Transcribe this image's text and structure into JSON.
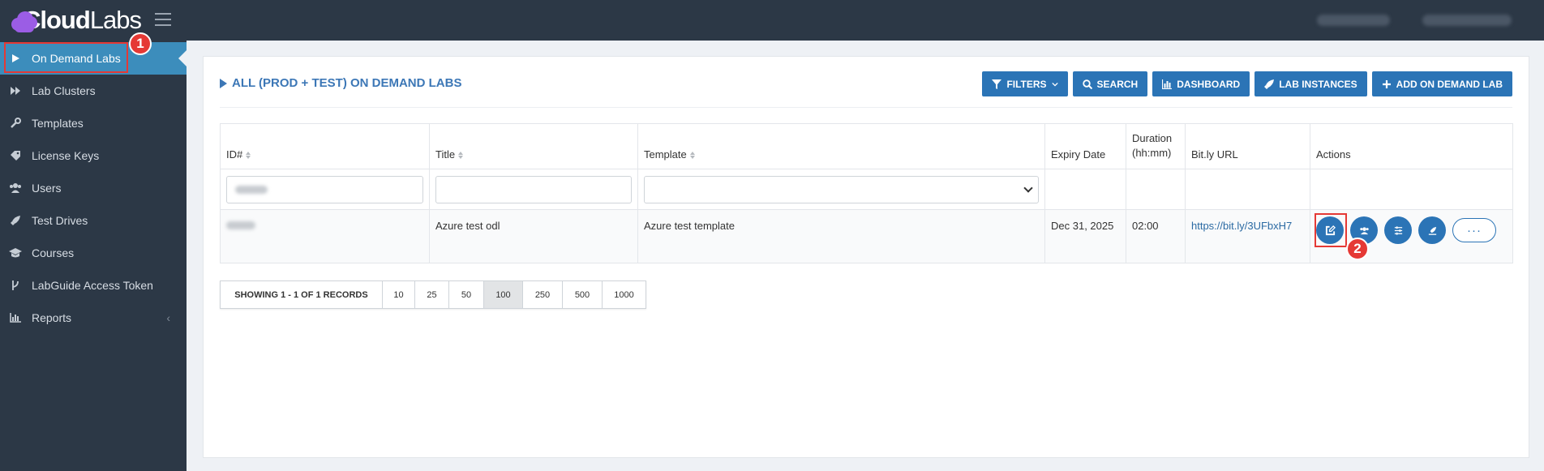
{
  "header": {
    "logo_bold": "Cloud",
    "logo_light": "Labs"
  },
  "sidebar": {
    "items": [
      {
        "label": "On Demand Labs",
        "icon": "play-icon",
        "active": true
      },
      {
        "label": "Lab Clusters",
        "icon": "fast-forward-icon"
      },
      {
        "label": "Templates",
        "icon": "wrench-icon"
      },
      {
        "label": "License Keys",
        "icon": "tag-icon"
      },
      {
        "label": "Users",
        "icon": "users-icon"
      },
      {
        "label": "Test Drives",
        "icon": "rocket-icon"
      },
      {
        "label": "Courses",
        "icon": "graduation-cap-icon"
      },
      {
        "label": "LabGuide Access Token",
        "icon": "branch-icon"
      },
      {
        "label": "Reports",
        "icon": "bar-chart-icon"
      }
    ]
  },
  "panel": {
    "title": "ALL (PROD + TEST) ON DEMAND LABS",
    "toolbar": {
      "filters": "FILTERS",
      "search": "SEARCH",
      "dashboard": "DASHBOARD",
      "lab_instances": "LAB INSTANCES",
      "add": "ADD ON DEMAND LAB"
    }
  },
  "table": {
    "headers": {
      "id": "ID#",
      "title": "Title",
      "template": "Template",
      "expiry": "Expiry Date",
      "duration_line1": "Duration",
      "duration_line2": "(hh:mm)",
      "bitly": "Bit.ly URL",
      "actions": "Actions"
    },
    "rows": [
      {
        "title": "Azure test odl",
        "template": "Azure test template",
        "expiry": "Dec 31, 2025",
        "duration": "02:00",
        "bitly": "https://bit.ly/3UFbxH7"
      }
    ],
    "more_label": "···"
  },
  "pager": {
    "info": "SHOWING 1 - 1 OF 1 RECORDS",
    "sizes": [
      "10",
      "25",
      "50",
      "100",
      "250",
      "500",
      "1000"
    ],
    "selected": "100"
  },
  "annotations": {
    "step1": "1",
    "step2": "2"
  },
  "colors": {
    "primary": "#2b74b6",
    "sidebar_bg": "#2c3846",
    "active_item": "#3c8dbc",
    "callout": "#e53935"
  }
}
